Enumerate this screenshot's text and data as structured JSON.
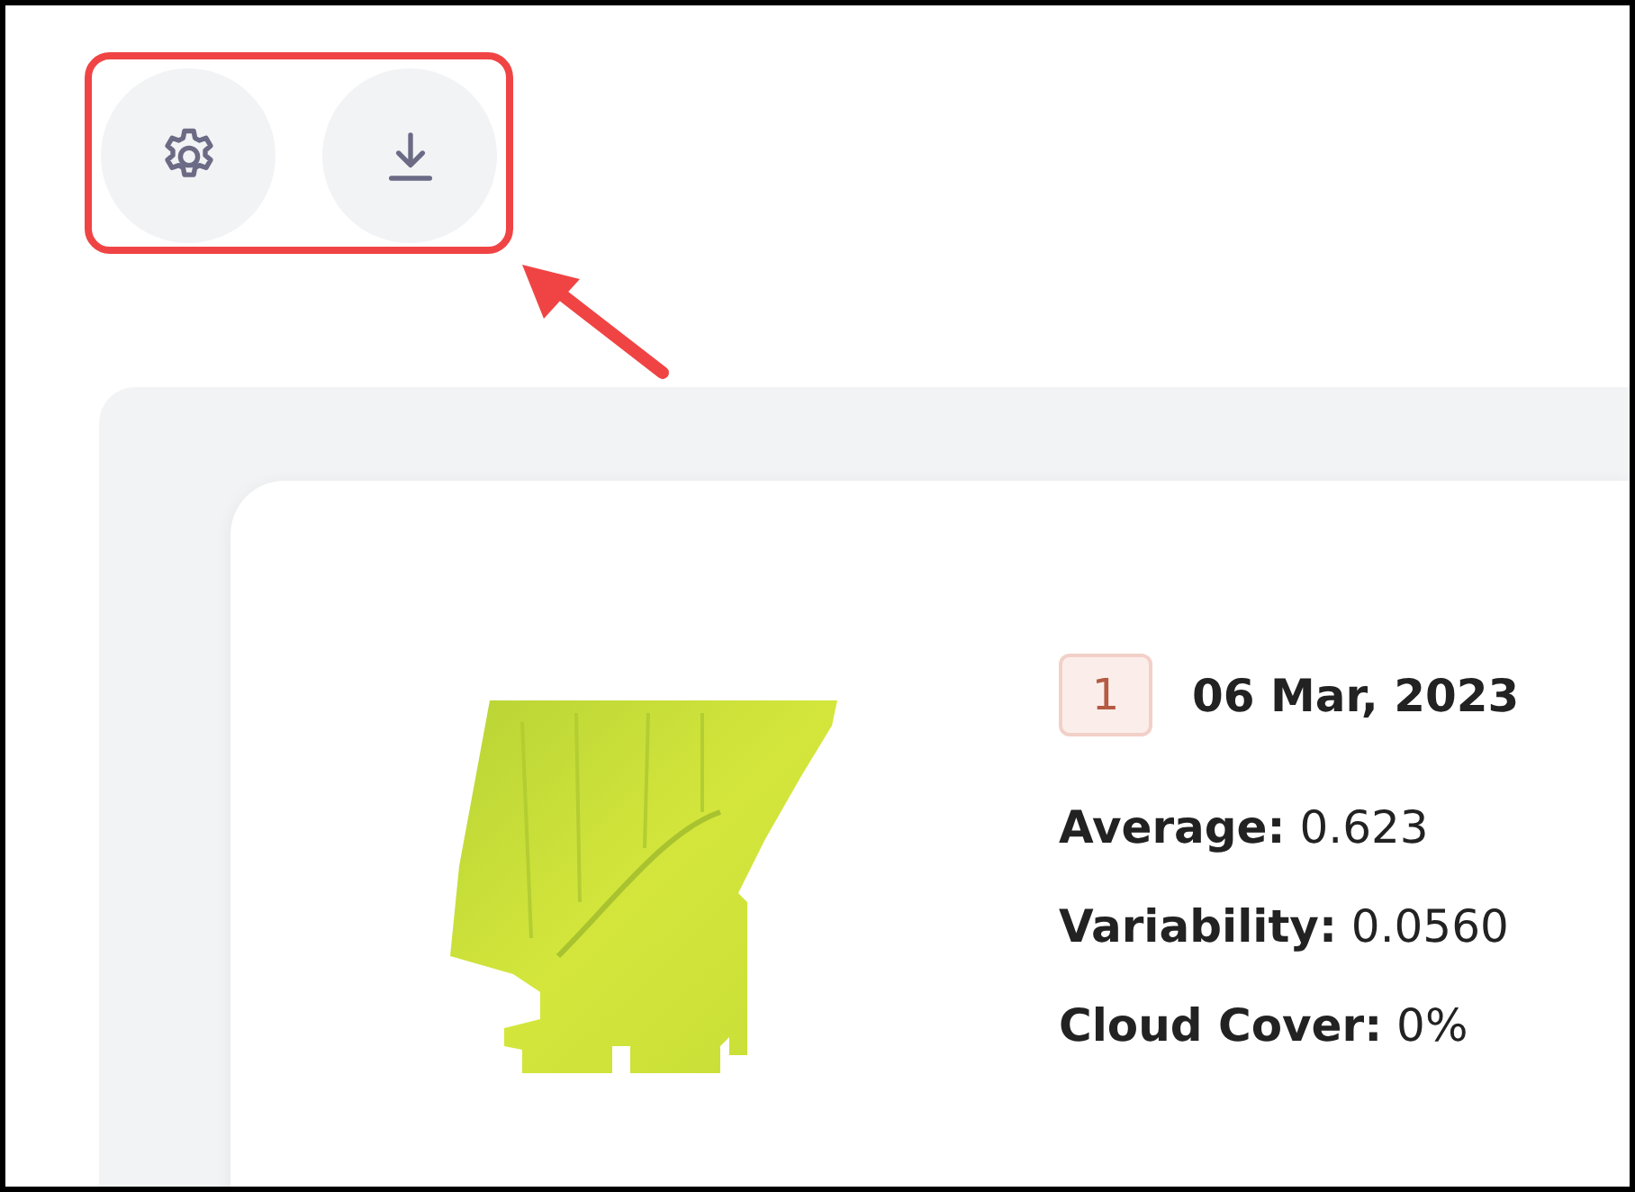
{
  "toolbar": {
    "buttons": [
      {
        "kind": "settings"
      },
      {
        "kind": "download"
      }
    ]
  },
  "card": {
    "badge": "1",
    "date": "06 Mar, 2023",
    "stats": [
      "**Average:** 0.623",
      "**Variability:** 0.0560",
      "**Cloud Cover:** 0%"
    ]
  }
}
